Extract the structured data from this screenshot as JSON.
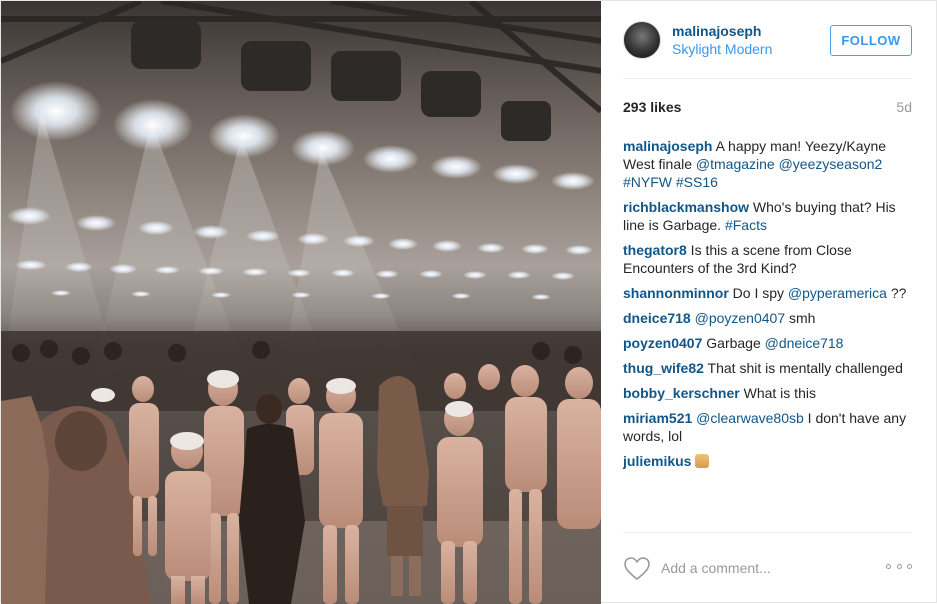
{
  "post": {
    "username": "malinajoseph",
    "location": "Skylight Modern",
    "follow_label": "FOLLOW",
    "likes": "293 likes",
    "age": "5d"
  },
  "comments": [
    {
      "author": "malinajoseph",
      "parts": [
        {
          "t": " A happy man! Yeezy/Kayne West finale ",
          "tag": false
        },
        {
          "t": "@tmagazine",
          "tag": true
        },
        {
          "t": " ",
          "tag": false
        },
        {
          "t": "@yeezyseason2",
          "tag": true
        },
        {
          "t": " ",
          "tag": false
        },
        {
          "t": "#NYFW",
          "tag": true
        },
        {
          "t": " ",
          "tag": false
        },
        {
          "t": "#SS16",
          "tag": true
        }
      ]
    },
    {
      "author": "richblackmanshow",
      "parts": [
        {
          "t": " Who's buying that? His line is Garbage. ",
          "tag": false
        },
        {
          "t": "#Facts",
          "tag": true
        }
      ]
    },
    {
      "author": "thegator8",
      "parts": [
        {
          "t": " Is this a scene from Close Encounters of the 3rd Kind?",
          "tag": false
        }
      ]
    },
    {
      "author": "shannonminnor",
      "parts": [
        {
          "t": " Do I spy ",
          "tag": false
        },
        {
          "t": "@pyperamerica",
          "tag": true
        },
        {
          "t": " ??",
          "tag": false
        }
      ]
    },
    {
      "author": "dneice718",
      "parts": [
        {
          "t": " ",
          "tag": false
        },
        {
          "t": "@poyzen0407",
          "tag": true
        },
        {
          "t": " smh",
          "tag": false
        }
      ]
    },
    {
      "author": "poyzen0407",
      "parts": [
        {
          "t": " Garbage ",
          "tag": false
        },
        {
          "t": "@dneice718",
          "tag": true
        }
      ]
    },
    {
      "author": "thug_wife82",
      "parts": [
        {
          "t": " That shit is mentally challenged",
          "tag": false
        }
      ]
    },
    {
      "author": "bobby_kerschner",
      "parts": [
        {
          "t": " What is this",
          "tag": false
        }
      ]
    },
    {
      "author": "miriam521",
      "parts": [
        {
          "t": " ",
          "tag": false
        },
        {
          "t": "@clearwave80sb",
          "tag": true
        },
        {
          "t": " I don't have any words, lol",
          "tag": false
        }
      ]
    },
    {
      "author": "juliemikus",
      "parts": [],
      "emoji": "thumbs-down-icon"
    }
  ],
  "footer": {
    "comment_placeholder": "Add a comment...",
    "like_icon": "heart-icon",
    "more_icon": "more-options-icon"
  }
}
